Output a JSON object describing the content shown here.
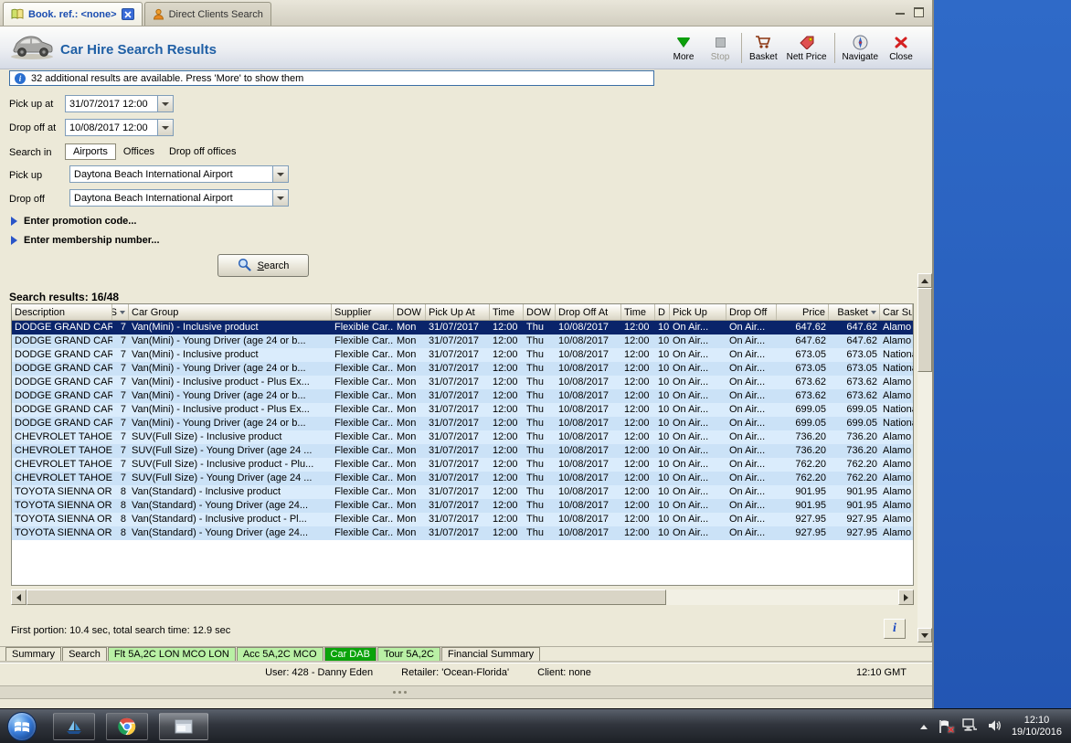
{
  "colors": {
    "desktop_blue": "#2f6ac8",
    "selected_row": "#0a246a",
    "row_blue_a": "#cbe2f7",
    "row_blue_b": "#daecfc",
    "title_blue": "#1f5fa5",
    "active_tab_green": "#0aa30a",
    "light_tab_green": "#b9f0a5"
  },
  "glyphs": {
    "info_i": "i"
  },
  "window": {
    "doc_tabs": [
      {
        "label": "Book. ref.: <none>"
      },
      {
        "label": "Direct Clients Search"
      }
    ]
  },
  "header": {
    "title": "Car Hire Search Results",
    "toolbar": [
      {
        "label": "More"
      },
      {
        "label": "Stop",
        "disabled": true
      },
      {
        "label": "Basket"
      },
      {
        "label": "Nett Price"
      },
      {
        "label": "Navigate"
      },
      {
        "label": "Close"
      }
    ],
    "info_message": "32 additional results are available. Press 'More' to show them"
  },
  "form": {
    "pickup_at_label": "Pick up at",
    "pickup_at_value": "31/07/2017 12:00",
    "dropoff_at_label": "Drop off at",
    "dropoff_at_value": "10/08/2017 12:00",
    "search_in_label": "Search in",
    "search_in_tabs": [
      "Airports",
      "Offices",
      "Drop off offices"
    ],
    "pickup_label": "Pick up",
    "pickup_value": "Daytona Beach International Airport",
    "dropoff_label": "Drop off",
    "dropoff_value": "Daytona Beach International Airport",
    "promo_toggle": "Enter promotion code...",
    "membership_toggle": "Enter membership number...",
    "search_button": "Search"
  },
  "results": {
    "summary": "Search results: 16/48",
    "timing": "First portion: 10.4 sec, total search time: 12.9 sec",
    "columns": [
      {
        "label": "Description"
      },
      {
        "label": "S",
        "icon": "filter-icon"
      },
      {
        "label": "Car Group"
      },
      {
        "label": "Supplier"
      },
      {
        "label": "DOW"
      },
      {
        "label": "Pick Up At"
      },
      {
        "label": "Time"
      },
      {
        "label": "DOW"
      },
      {
        "label": "Drop Off At"
      },
      {
        "label": "Time"
      },
      {
        "label": "D"
      },
      {
        "label": "Pick Up"
      },
      {
        "label": "Drop Off"
      },
      {
        "label": "Price"
      },
      {
        "label": "Basket",
        "icon": "sort-desc-icon"
      },
      {
        "label": "Car Su..."
      }
    ],
    "rows": [
      {
        "selected": true,
        "cells": [
          "DODGE GRAND CAR...",
          "7",
          "Van(Mini) - Inclusive product",
          "Flexible Car...",
          "Mon",
          "31/07/2017",
          "12:00",
          "Thu",
          "10/08/2017",
          "12:00",
          "10",
          "On Air...",
          "On Air...",
          "647.62",
          "647.62",
          "Alamo"
        ]
      },
      {
        "cells": [
          "DODGE GRAND CAR...",
          "7",
          "Van(Mini) - Young Driver (age 24 or b...",
          "Flexible Car...",
          "Mon",
          "31/07/2017",
          "12:00",
          "Thu",
          "10/08/2017",
          "12:00",
          "10",
          "On Air...",
          "On Air...",
          "647.62",
          "647.62",
          "Alamo"
        ]
      },
      {
        "cells": [
          "DODGE GRAND CAR...",
          "7",
          "Van(Mini) - Inclusive product",
          "Flexible Car...",
          "Mon",
          "31/07/2017",
          "12:00",
          "Thu",
          "10/08/2017",
          "12:00",
          "10",
          "On Air...",
          "On Air...",
          "673.05",
          "673.05",
          "National"
        ]
      },
      {
        "cells": [
          "DODGE GRAND CAR...",
          "7",
          "Van(Mini) - Young Driver (age 24 or b...",
          "Flexible Car...",
          "Mon",
          "31/07/2017",
          "12:00",
          "Thu",
          "10/08/2017",
          "12:00",
          "10",
          "On Air...",
          "On Air...",
          "673.05",
          "673.05",
          "National"
        ]
      },
      {
        "cells": [
          "DODGE GRAND CAR...",
          "7",
          "Van(Mini) - Inclusive product - Plus Ex...",
          "Flexible Car...",
          "Mon",
          "31/07/2017",
          "12:00",
          "Thu",
          "10/08/2017",
          "12:00",
          "10",
          "On Air...",
          "On Air...",
          "673.62",
          "673.62",
          "Alamo"
        ]
      },
      {
        "cells": [
          "DODGE GRAND CAR...",
          "7",
          "Van(Mini) - Young Driver (age 24 or b...",
          "Flexible Car...",
          "Mon",
          "31/07/2017",
          "12:00",
          "Thu",
          "10/08/2017",
          "12:00",
          "10",
          "On Air...",
          "On Air...",
          "673.62",
          "673.62",
          "Alamo"
        ]
      },
      {
        "cells": [
          "DODGE GRAND CAR...",
          "7",
          "Van(Mini) - Inclusive product - Plus Ex...",
          "Flexible Car...",
          "Mon",
          "31/07/2017",
          "12:00",
          "Thu",
          "10/08/2017",
          "12:00",
          "10",
          "On Air...",
          "On Air...",
          "699.05",
          "699.05",
          "National"
        ]
      },
      {
        "cells": [
          "DODGE GRAND CAR...",
          "7",
          "Van(Mini) - Young Driver (age 24 or b...",
          "Flexible Car...",
          "Mon",
          "31/07/2017",
          "12:00",
          "Thu",
          "10/08/2017",
          "12:00",
          "10",
          "On Air...",
          "On Air...",
          "699.05",
          "699.05",
          "National"
        ]
      },
      {
        "cells": [
          "CHEVROLET TAHOE ...",
          "7",
          "SUV(Full Size) - Inclusive product",
          "Flexible Car...",
          "Mon",
          "31/07/2017",
          "12:00",
          "Thu",
          "10/08/2017",
          "12:00",
          "10",
          "On Air...",
          "On Air...",
          "736.20",
          "736.20",
          "Alamo"
        ]
      },
      {
        "cells": [
          "CHEVROLET TAHOE ...",
          "7",
          "SUV(Full Size) - Young Driver (age 24 ...",
          "Flexible Car...",
          "Mon",
          "31/07/2017",
          "12:00",
          "Thu",
          "10/08/2017",
          "12:00",
          "10",
          "On Air...",
          "On Air...",
          "736.20",
          "736.20",
          "Alamo"
        ]
      },
      {
        "cells": [
          "CHEVROLET TAHOE ...",
          "7",
          "SUV(Full Size) - Inclusive product - Plu...",
          "Flexible Car...",
          "Mon",
          "31/07/2017",
          "12:00",
          "Thu",
          "10/08/2017",
          "12:00",
          "10",
          "On Air...",
          "On Air...",
          "762.20",
          "762.20",
          "Alamo"
        ]
      },
      {
        "cells": [
          "CHEVROLET TAHOE ...",
          "7",
          "SUV(Full Size) - Young Driver (age 24 ...",
          "Flexible Car...",
          "Mon",
          "31/07/2017",
          "12:00",
          "Thu",
          "10/08/2017",
          "12:00",
          "10",
          "On Air...",
          "On Air...",
          "762.20",
          "762.20",
          "Alamo"
        ]
      },
      {
        "cells": [
          "TOYOTA SIENNA OR ...",
          "8",
          "Van(Standard) - Inclusive product",
          "Flexible Car...",
          "Mon",
          "31/07/2017",
          "12:00",
          "Thu",
          "10/08/2017",
          "12:00",
          "10",
          "On Air...",
          "On Air...",
          "901.95",
          "901.95",
          "Alamo"
        ]
      },
      {
        "cells": [
          "TOYOTA SIENNA OR ...",
          "8",
          "Van(Standard) - Young Driver (age 24...",
          "Flexible Car...",
          "Mon",
          "31/07/2017",
          "12:00",
          "Thu",
          "10/08/2017",
          "12:00",
          "10",
          "On Air...",
          "On Air...",
          "901.95",
          "901.95",
          "Alamo"
        ]
      },
      {
        "cells": [
          "TOYOTA SIENNA OR ...",
          "8",
          "Van(Standard) - Inclusive product - Pl...",
          "Flexible Car...",
          "Mon",
          "31/07/2017",
          "12:00",
          "Thu",
          "10/08/2017",
          "12:00",
          "10",
          "On Air...",
          "On Air...",
          "927.95",
          "927.95",
          "Alamo"
        ]
      },
      {
        "cells": [
          "TOYOTA SIENNA OR ...",
          "8",
          "Van(Standard) - Young Driver (age 24...",
          "Flexible Car...",
          "Mon",
          "31/07/2017",
          "12:00",
          "Thu",
          "10/08/2017",
          "12:00",
          "10",
          "On Air...",
          "On Air...",
          "927.95",
          "927.95",
          "Alamo"
        ]
      }
    ]
  },
  "bottom_tabs": [
    {
      "label": "Summary",
      "style": "plain"
    },
    {
      "label": "Search",
      "style": "plain"
    },
    {
      "label": "Flt 5A,2C LON MCO LON",
      "style": "green"
    },
    {
      "label": "Acc 5A,2C MCO",
      "style": "green"
    },
    {
      "label": "Car DAB",
      "style": "active"
    },
    {
      "label": "Tour 5A,2C",
      "style": "green"
    },
    {
      "label": "Financial Summary",
      "style": "plain"
    }
  ],
  "status_bar": {
    "user": "User: 428 - Danny Eden",
    "retailer": "Retailer: 'Ocean-Florida'",
    "client": "Client: none",
    "time": "12:10 GMT"
  },
  "taskbar": {
    "clock_time": "12:10",
    "clock_date": "19/10/2016"
  }
}
